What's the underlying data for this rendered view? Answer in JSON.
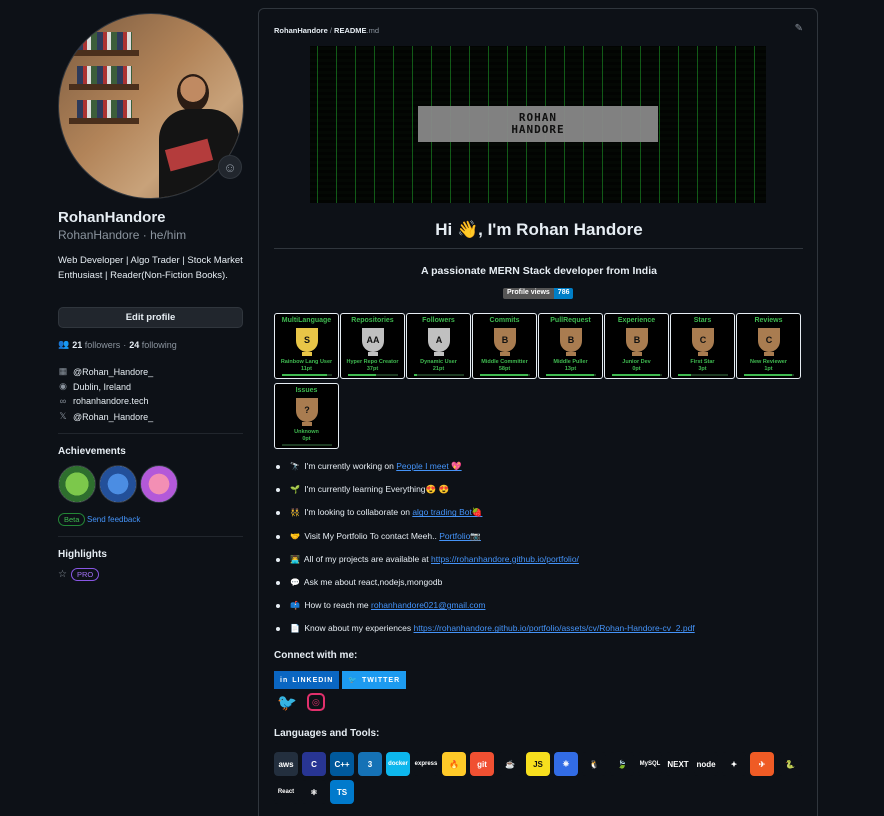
{
  "profile": {
    "display_name": "RohanHandore",
    "login": "RohanHandore",
    "pronouns": "he/him",
    "bio": "Web Developer | Algo Trader | Stock Market Enthusiast | Reader(Non-Fiction Books).",
    "edit_label": "Edit profile",
    "followers_count": "21",
    "followers_label": "followers",
    "following_count": "24",
    "following_label": "following",
    "separator": "·",
    "org": "@Rohan_Handore_",
    "location": "Dublin, Ireland",
    "website": "rohanhandore.tech",
    "x_handle": "@Rohan_Handore_"
  },
  "achievements": {
    "title": "Achievements",
    "beta_label": "Beta",
    "feedback_label": "Send feedback"
  },
  "highlights": {
    "title": "Highlights",
    "pro_label": "PRO"
  },
  "readme": {
    "path_user": "RohanHandore",
    "path_sep": "/",
    "path_file": "README",
    "path_ext": ".md",
    "banner_line1": "ROHAN",
    "banner_line2": "HANDORE",
    "greeting": "Hi 👋, I'm Rohan Handore",
    "tagline": "A passionate MERN Stack developer from India",
    "views_label": "Profile views",
    "views_count": "786",
    "trophies": [
      {
        "title": "MultiLanguage",
        "rank": "S",
        "subtitle": "Rainbow Lang User",
        "points": "11pt",
        "progress": 0.9,
        "color": "#e8c547"
      },
      {
        "title": "Repositories",
        "rank": "AA",
        "subtitle": "Hyper Repo Creator",
        "points": "37pt",
        "progress": 0.55,
        "color": "#c0c0c0"
      },
      {
        "title": "Followers",
        "rank": "A",
        "subtitle": "Dynamic User",
        "points": "21pt",
        "progress": 0.05,
        "color": "#c0c0c0"
      },
      {
        "title": "Commits",
        "rank": "B",
        "subtitle": "Middle Committer",
        "points": "58pt",
        "progress": 0.95,
        "color": "#a97c50"
      },
      {
        "title": "PullRequest",
        "rank": "B",
        "subtitle": "Middle Puller",
        "points": "13pt",
        "progress": 0.95,
        "color": "#a97c50"
      },
      {
        "title": "Experience",
        "rank": "B",
        "subtitle": "Junior Dev",
        "points": "0pt",
        "progress": 0.95,
        "color": "#a97c50"
      },
      {
        "title": "Stars",
        "rank": "C",
        "subtitle": "First Star",
        "points": "3pt",
        "progress": 0.25,
        "color": "#a97c50"
      },
      {
        "title": "Reviews",
        "rank": "C",
        "subtitle": "New Reviewer",
        "points": "1pt",
        "progress": 0.95,
        "color": "#a97c50"
      },
      {
        "title": "Issues",
        "rank": "?",
        "subtitle": "Unknown",
        "points": "0pt",
        "progress": 0.0,
        "color": "#a97c50"
      }
    ],
    "bullets": [
      {
        "emoji": "🔭",
        "text": "I'm currently working on ",
        "link": "People I meet 💖",
        "tail": ""
      },
      {
        "emoji": "🌱",
        "text": "I'm currently learning Everything😍 😍",
        "link": "",
        "tail": ""
      },
      {
        "emoji": "👯",
        "text": "I'm looking to collaborate on ",
        "link": "algo trading Bot🍓",
        "tail": ""
      },
      {
        "emoji": "🤝",
        "text": "Visit My Portfolio To contact Meeh.. ",
        "link": "Portfolio📷",
        "tail": ""
      },
      {
        "emoji": "👨‍💻",
        "text": "All of my projects are available at ",
        "link": "https://rohanhandore.github.io/portfolio/",
        "tail": ""
      },
      {
        "emoji": "💬",
        "text": "Ask me about react,nodejs,mongodb",
        "link": "",
        "tail": ""
      },
      {
        "emoji": "📫",
        "text": "How to reach me ",
        "link": "rohanhandore021@gmail.com",
        "tail": ""
      },
      {
        "emoji": "📄",
        "text": "Know about my experiences ",
        "link": "https://rohanhandore.github.io/portfolio/assets/cv/Rohan-Handore-cv_2.pdf",
        "tail": ""
      }
    ],
    "connect_title": "Connect with me:",
    "linkedin_label": "LINKEDIN",
    "twitter_label": "TWITTER",
    "tools_title": "Languages and Tools:",
    "tools": [
      {
        "name": "aws",
        "label": "aws",
        "color": "#232f3e"
      },
      {
        "name": "c",
        "label": "C",
        "color": "#283593"
      },
      {
        "name": "cplusplus",
        "label": "C++",
        "color": "#00599c"
      },
      {
        "name": "css3",
        "label": "3",
        "color": "#1572b6"
      },
      {
        "name": "docker",
        "label": "docker",
        "color": "#0db7ed"
      },
      {
        "name": "express",
        "label": "express",
        "color": "#0d1117"
      },
      {
        "name": "firebase",
        "label": "🔥",
        "color": "#ffca28"
      },
      {
        "name": "git",
        "label": "git",
        "color": "#f05032"
      },
      {
        "name": "java",
        "label": "☕",
        "color": "#0d1117"
      },
      {
        "name": "javascript",
        "label": "JS",
        "color": "#f7df1e"
      },
      {
        "name": "kubernetes",
        "label": "⎈",
        "color": "#326ce5"
      },
      {
        "name": "linux",
        "label": "🐧",
        "color": "#0d1117"
      },
      {
        "name": "mongodb",
        "label": "🍃",
        "color": "#0d1117"
      },
      {
        "name": "mysql",
        "label": "MySQL",
        "color": "#0d1117"
      },
      {
        "name": "nextjs",
        "label": "NEXT",
        "color": "#0d1117"
      },
      {
        "name": "nodejs",
        "label": "node",
        "color": "#0d1117"
      },
      {
        "name": "numpy",
        "label": "✦",
        "color": "#0d1117"
      },
      {
        "name": "postman",
        "label": "✈",
        "color": "#ef5b25"
      },
      {
        "name": "python",
        "label": "🐍",
        "color": "#0d1117"
      },
      {
        "name": "react",
        "label": "React",
        "color": "#0d1117"
      },
      {
        "name": "react-native",
        "label": "⚛",
        "color": "#0d1117"
      },
      {
        "name": "typescript",
        "label": "TS",
        "color": "#007acc"
      }
    ]
  },
  "colors": {
    "bg": "#0d1117",
    "border": "#30363d",
    "link": "#4493f8",
    "trophy_green": "#3fb950"
  }
}
